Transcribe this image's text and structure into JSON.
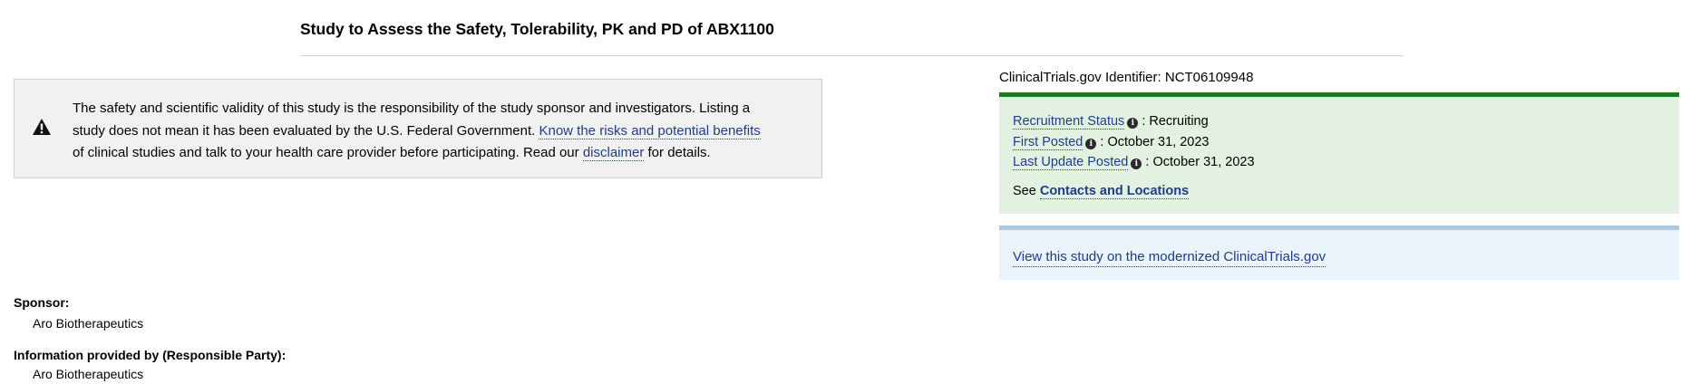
{
  "page": {
    "title": "Study to Assess the Safety, Tolerability, PK and PD of ABX1100"
  },
  "disclaimer": {
    "icon": "warning-icon",
    "line1": "The safety and scientific validity of this study is the responsibility of the study sponsor and investigators. Listing a",
    "line2_text": "study does not mean it has been evaluated by the U.S. Federal Government.",
    "risks_link": "Know the risks and potential benefits",
    "line3_text": "of clinical studies and talk to your health care provider before participating. Read our",
    "disclaimer_link": "disclaimer",
    "line3_end": "for details."
  },
  "identifier": {
    "label": "ClinicalTrials.gov Identifier:",
    "value": "NCT06109948"
  },
  "status": {
    "accent_color": "#1f7a1f",
    "background_color": "#e3f2e0",
    "recruitment_label": "Recruitment Status",
    "recruitment_value": ": Recruiting",
    "first_posted_label": "First Posted",
    "first_posted_value": ": October 31, 2023",
    "last_update_label": "Last Update Posted",
    "last_update_value": ": October 31, 2023",
    "see_label": "See",
    "contacts_link": "Contacts and Locations",
    "info_icon": "info-icon"
  },
  "modernized": {
    "accent_color": "#a9c9e6",
    "link": "View this study on the modernized ClinicalTrials.gov"
  },
  "sponsor": {
    "label": "Sponsor:",
    "value": "Aro Biotherapeutics"
  },
  "responsible_party": {
    "label": "Information provided by (Responsible Party):",
    "value": "Aro Biotherapeutics"
  }
}
